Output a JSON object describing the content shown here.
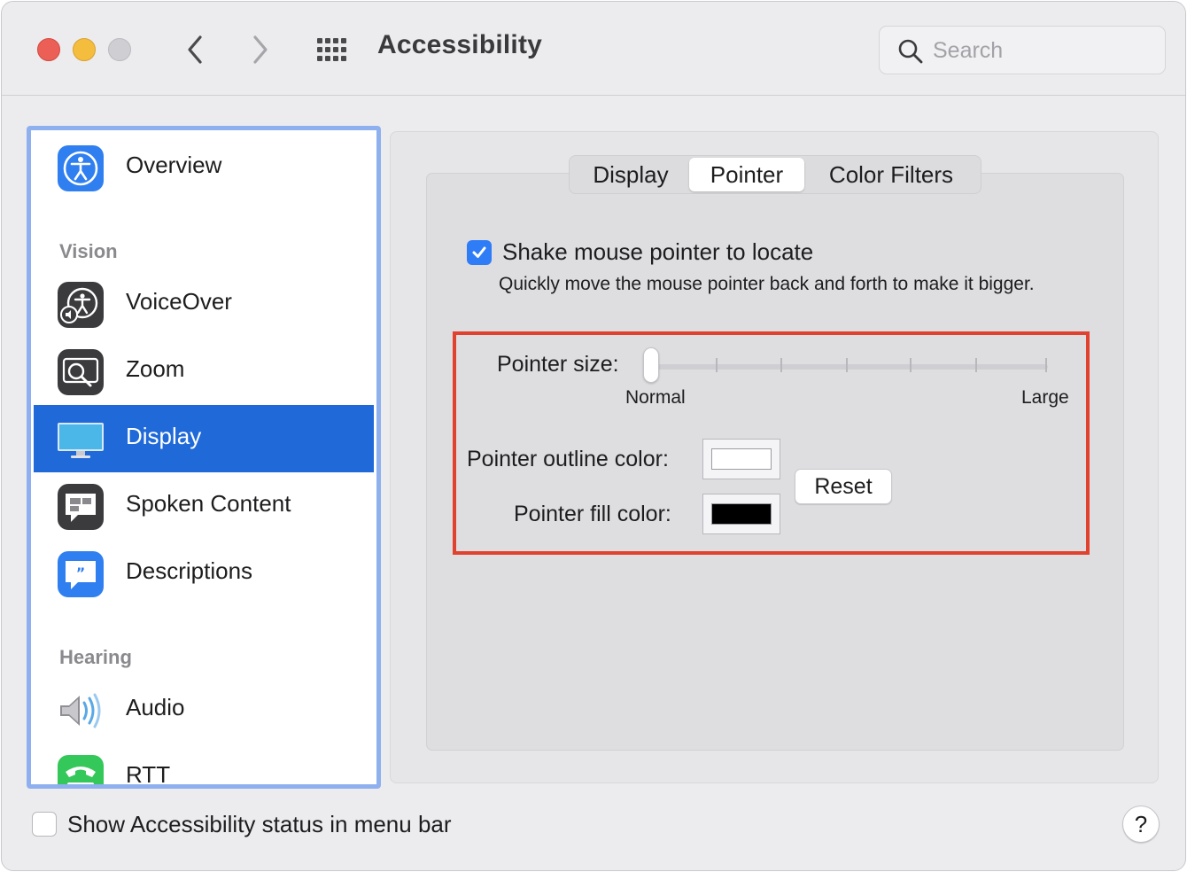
{
  "window": {
    "title": "Accessibility"
  },
  "search": {
    "placeholder": "Search"
  },
  "sidebar": {
    "items": [
      {
        "label": "Overview",
        "icon": "accessibility-icon"
      },
      {
        "section": "Vision"
      },
      {
        "label": "VoiceOver",
        "icon": "voiceover-icon"
      },
      {
        "label": "Zoom",
        "icon": "zoom-icon"
      },
      {
        "label": "Display",
        "icon": "display-icon",
        "selected": true
      },
      {
        "label": "Spoken Content",
        "icon": "spoken-content-icon"
      },
      {
        "label": "Descriptions",
        "icon": "descriptions-icon"
      },
      {
        "section": "Hearing"
      },
      {
        "label": "Audio",
        "icon": "speaker-icon"
      },
      {
        "label": "RTT",
        "icon": "rtt-phone-icon"
      }
    ]
  },
  "tabs": [
    {
      "label": "Display",
      "selected": false
    },
    {
      "label": "Pointer",
      "selected": true
    },
    {
      "label": "Color Filters",
      "selected": false
    }
  ],
  "pointer": {
    "shake_label": "Shake mouse pointer to locate",
    "shake_checked": true,
    "shake_description": "Quickly move the mouse pointer back and forth to make it bigger.",
    "size_label": "Pointer size:",
    "size_min_label": "Normal",
    "size_max_label": "Large",
    "size_value_fraction": 0.0,
    "outline_label": "Pointer outline color:",
    "outline_color": "#ffffff",
    "fill_label": "Pointer fill color:",
    "fill_color": "#000000",
    "reset_label": "Reset"
  },
  "footer": {
    "status_label": "Show Accessibility status in menu bar",
    "status_checked": false,
    "help_label": "?"
  },
  "colors": {
    "selection": "#1f69d8",
    "checkbox": "#2f7df6",
    "highlight": "#e1412f",
    "sidebar_focus": "#8fb0ef"
  }
}
